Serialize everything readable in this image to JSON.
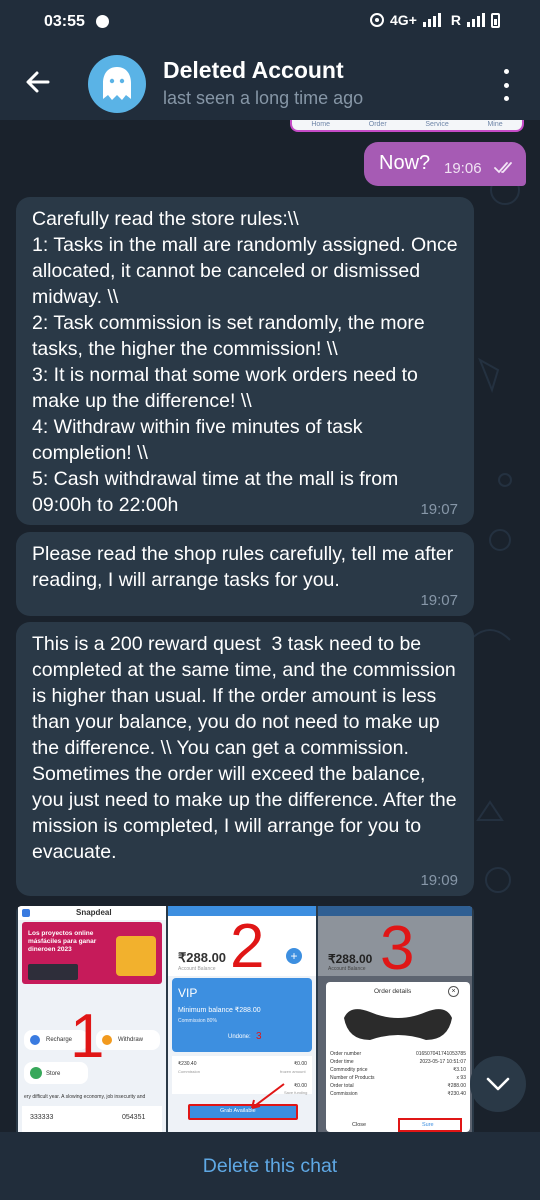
{
  "status_bar": {
    "time": "03:55",
    "network": "4G+",
    "roaming": "R"
  },
  "header": {
    "title": "Deleted Account",
    "subtitle": "last seen a long time ago"
  },
  "prev_image_tabs": [
    "Home",
    "Order",
    "Service",
    "Mine"
  ],
  "messages": [
    {
      "direction": "out",
      "text": "Now?",
      "time": "19:06"
    },
    {
      "direction": "in",
      "text": "Carefully read the store rules:\\\\\n1: Tasks in the mall are randomly assigned. Once allocated, it cannot be canceled or dismissed midway. \\\\\n2: Task commission is set randomly, the more tasks, the higher the commission! \\\\\n3: It is normal that some work orders need to make up the difference! \\\\\n4: Withdraw within five minutes of task completion! \\\\\n5: Cash withdrawal time at the mall is from 09:00h to 22:00h",
      "time": "19:07"
    },
    {
      "direction": "in",
      "text": "Please read the shop rules carefully, tell me after reading, I will arrange tasks for you.",
      "time": "19:07"
    },
    {
      "direction": "in",
      "text": "This is a 200 reward quest  3 task need to be completed at the same time, and the commission is higher than usual. If the order amount is less than your balance, you do not need to make up the difference. \\\\ You can get a commission. Sometimes the order will exceed the balance, you just need to make up the difference. After the mission is completed, I will arrange for you to evacuate.",
      "time": "19:09"
    }
  ],
  "image_message": {
    "shot1": {
      "app": "Snapdeal",
      "banner": "Los proyectos online másfáciles para ganar dineroen 2023",
      "recharge": "Recharge",
      "withdraw": "Withdraw",
      "store": "Store",
      "ticker": "ery difficult year. A slowing economy, job insecurity and",
      "stat_left": "333333",
      "stat_right": "054351",
      "marker": "1"
    },
    "shot2": {
      "balance": "₹288.00",
      "balance_label": "Account Balance",
      "vip": "VIP",
      "min_balance": "Minimum balance ₹288.00",
      "commission_pct": "Commission 80%",
      "undone_label": "Undone:",
      "undone_value": "3",
      "row1_left": "₹230.40",
      "row1_left_label": "Commission",
      "row1_right": "₹0.00",
      "row1_right_label": "frozen amount",
      "row2_right": "₹0.00",
      "row2_right_label": "Save funding",
      "grab": "Grab Available",
      "marker": "2"
    },
    "shot3": {
      "balance": "₹288.00",
      "balance_label": "Account Balance",
      "dialog_title": "Order details",
      "rows": [
        {
          "label": "Order number",
          "value": "016507041741053785"
        },
        {
          "label": "Order time",
          "value": "2023-05-17 10:51:07"
        },
        {
          "label": "Commodity price",
          "value": "₹3.10"
        },
        {
          "label": "Number of Products",
          "value": "x 93"
        },
        {
          "label": "Order total",
          "value": "₹288.00"
        },
        {
          "label": "Commission",
          "value": "₹230.40"
        }
      ],
      "close": "Close",
      "submit": "Sure",
      "marker": "3"
    }
  },
  "bottom_bar": {
    "action": "Delete this chat"
  },
  "colors": {
    "accent": "#5fa8e4",
    "out_bubble": "#a65bb4",
    "in_bubble": "#2a3947",
    "bg": "#1a222c"
  }
}
